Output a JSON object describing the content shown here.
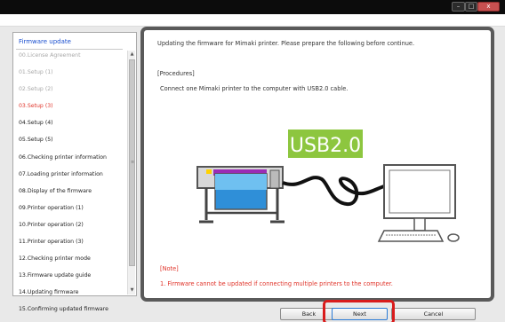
{
  "window": {
    "controls": {
      "minimize": "–",
      "maximize": "□",
      "close": "x"
    }
  },
  "sidebar": {
    "title": "Firmware update",
    "steps": [
      {
        "label": "00.License Agreement",
        "state": "done"
      },
      {
        "label": "01.Setup (1)",
        "state": "done"
      },
      {
        "label": "02.Setup (2)",
        "state": "done"
      },
      {
        "label": "03.Setup (3)",
        "state": "current"
      },
      {
        "label": "04.Setup (4)",
        "state": "pending"
      },
      {
        "label": "05.Setup (5)",
        "state": "pending"
      },
      {
        "label": "06.Checking printer information",
        "state": "pending"
      },
      {
        "label": "07.Loading printer information",
        "state": "pending"
      },
      {
        "label": "08.Display of the firmware",
        "state": "pending"
      },
      {
        "label": "09.Printer operation (1)",
        "state": "pending"
      },
      {
        "label": "10.Printer operation (2)",
        "state": "pending"
      },
      {
        "label": "11.Printer operation (3)",
        "state": "pending"
      },
      {
        "label": "12.Checking printer mode",
        "state": "pending"
      },
      {
        "label": "13.Firmware update guide",
        "state": "pending"
      },
      {
        "label": "14.Updating firmware",
        "state": "pending"
      },
      {
        "label": "15.Confirming updated firmware",
        "state": "pending"
      }
    ]
  },
  "main": {
    "intro": "Updating the firmware for Mimaki printer. Please prepare the following before continue.",
    "procedures_title": "[Procedures]",
    "procedures_text": "Connect one Mimaki printer to the computer with USB2.0 cable.",
    "illustration": {
      "usb_label": "USB2.0",
      "label_bg": "#8dc63f",
      "cable_color": "#111111"
    },
    "note_title": "[Note]",
    "note_text": "1.   Firmware cannot be updated if connecting multiple printers to the computer."
  },
  "buttons": {
    "back": "Back",
    "next": "Next",
    "cancel": "Cancel"
  },
  "colors": {
    "current_step": "#e0342a",
    "note": "#e0342a",
    "sidebar_title": "#1a4fcf",
    "highlight": "#d91c1c"
  }
}
